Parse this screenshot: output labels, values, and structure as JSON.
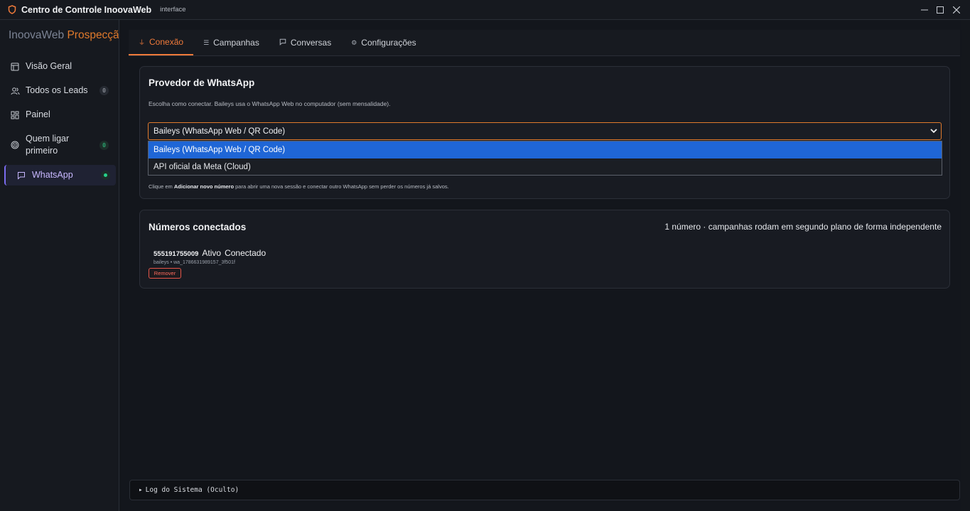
{
  "window": {
    "title": "Centro de Controle InoovaWeb",
    "subtitle": "interface",
    "minimize_icon": "minimize-icon",
    "maximize_icon": "maximize-icon",
    "close_icon": "close-icon"
  },
  "sidebar": {
    "brand_part1": "InoovaWeb",
    "brand_part2": " Prospecção",
    "items": [
      {
        "label": "Visão Geral",
        "icon": "layout-icon"
      },
      {
        "label": "Todos os Leads",
        "icon": "users-icon",
        "count": "0"
      },
      {
        "label": "Painel",
        "icon": "grid-icon"
      },
      {
        "label": "Quem ligar primeiro",
        "icon": "target-icon",
        "count": "0"
      },
      {
        "label": "WhatsApp",
        "icon": "chat-icon",
        "active": true
      }
    ]
  },
  "tabs": [
    {
      "label": "Conexão",
      "icon": "plug-icon",
      "active": true
    },
    {
      "label": "Campanhas",
      "icon": "list-icon"
    },
    {
      "label": "Conversas",
      "icon": "chat-icon"
    },
    {
      "label": "Configurações",
      "icon": "gear-icon"
    }
  ],
  "provider": {
    "title": "Provedor de WhatsApp",
    "description": "Escolha como conectar. Baileys usa o WhatsApp Web no computador (sem mensalidade).",
    "selected": "Baileys (WhatsApp Web / QR Code)",
    "options": [
      "Baileys (WhatsApp Web / QR Code)",
      "API oficial da Meta (Cloud)"
    ],
    "hint_prefix": "Clique em ",
    "hint_bold": "Adicionar novo número",
    "hint_suffix": " para abrir uma nova sessão e conectar outro WhatsApp sem perder os números já salvos."
  },
  "connected": {
    "title": "Números conectados",
    "summary": "1 número · campanhas rodam em segundo plano de forma independente",
    "numbers": [
      {
        "number": "555191755009",
        "status1": "Ativo",
        "status2": "Conectado",
        "meta": "baileys • wa_1786631989157_3f501f",
        "remove_label": "Remover"
      }
    ]
  },
  "log": {
    "label": "Log do Sistema (Oculto)"
  },
  "colors": {
    "accent": "#f07a3a",
    "active_nav": "#c8b8ff",
    "danger": "#e4564a",
    "success": "#25d18a",
    "selection": "#1f66d6"
  }
}
